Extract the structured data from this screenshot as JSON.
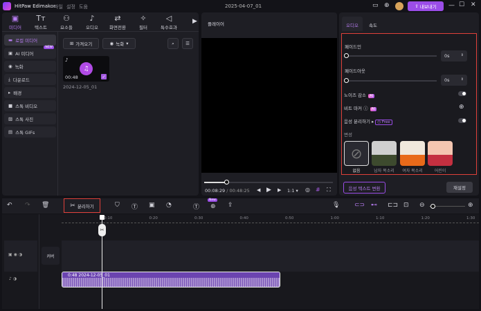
{
  "app": {
    "title": "HitPaw Edimakor",
    "menu": [
      "파일",
      "설정",
      "도움"
    ],
    "project": "2025-04-07_01",
    "export": "내보내기"
  },
  "tabs": [
    {
      "label": "미디어",
      "icon": "media-icon",
      "g": "▣"
    },
    {
      "label": "텍스트",
      "icon": "text-icon",
      "g": "Tт"
    },
    {
      "label": "요소들",
      "icon": "elements-icon",
      "g": "⚇"
    },
    {
      "label": "오디오",
      "icon": "audio-icon",
      "g": "♪"
    },
    {
      "label": "화면전환",
      "icon": "transition-icon",
      "g": "⇄"
    },
    {
      "label": "필터",
      "icon": "filter-icon",
      "g": "✧"
    },
    {
      "label": "특수효과",
      "icon": "effects-icon",
      "g": "◁"
    }
  ],
  "sidebar": [
    {
      "label": "로컬 미디어",
      "g": "▬"
    },
    {
      "label": "AI 미디어",
      "g": "▣",
      "badge": "NEW"
    },
    {
      "label": "녹화",
      "g": "◉"
    },
    {
      "label": "다운로드",
      "g": "⤓"
    },
    {
      "label": "배경",
      "g": "▸"
    },
    {
      "label": "스톡 비디오",
      "g": "■"
    },
    {
      "label": "스톡 사진",
      "g": "▨"
    },
    {
      "label": "스톡 GIFs",
      "g": "▤"
    }
  ],
  "media": {
    "import": "가져오기",
    "record": "녹화",
    "clip": {
      "duration": "00:48",
      "name": "2024-12-05_01"
    }
  },
  "player": {
    "title": "플레이어",
    "current": "00:08:29",
    "total": "00:48:25",
    "ratio": "1:1",
    "progress": 0.17
  },
  "right": {
    "tabs": [
      "오디오",
      "속도"
    ],
    "fade_in": "페이드인",
    "fade_in_value": "0s",
    "fade_out": "페이드아웃",
    "fade_out_value": "0s",
    "noise": "노이즈 감소",
    "beat": "비트 마커",
    "separate": "음성 분리하기",
    "free": "Free",
    "ai": "AI",
    "voice_title": "변성",
    "voices": [
      "없음",
      "남자 목소리",
      "여자 목소리",
      "어린이"
    ],
    "stt": "음성 텍스트 변환",
    "reset": "재설정"
  },
  "timeline": {
    "split": "분리하기",
    "new": "New",
    "cover": "커버",
    "ticks": [
      "0:10",
      "0:20",
      "0:30",
      "0:40",
      "0:50",
      "1:00",
      "1:10",
      "1:20",
      "1:30"
    ],
    "clip_label": "0:48 2024-12-05_01"
  },
  "colors": {
    "accent": "#9b4de8",
    "highlight": "#e0403a",
    "clip": "#a88fd0"
  }
}
